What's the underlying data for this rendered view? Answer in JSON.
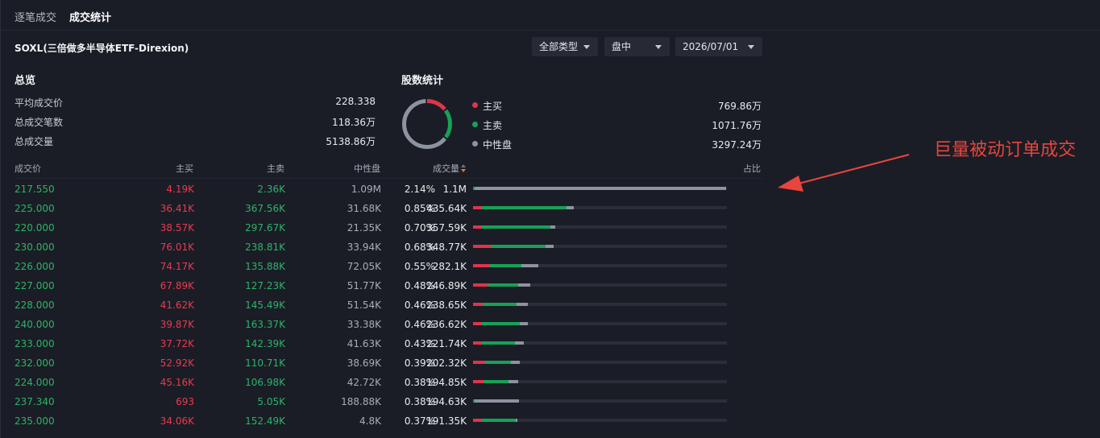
{
  "tabs": [
    "逐笔成交",
    "成交统计"
  ],
  "stock_title": "SOXL(三倍做多半导体ETF-Direxion)",
  "filters": {
    "type": "全部类型",
    "session": "盘中",
    "date": "2026/07/01"
  },
  "overview": {
    "title": "总览",
    "rows": [
      {
        "label": "平均成交价",
        "value": "228.338"
      },
      {
        "label": "总成交笔数",
        "value": "118.36万"
      },
      {
        "label": "总成交量",
        "value": "5138.86万"
      }
    ]
  },
  "share_stats": {
    "title": "股数统计",
    "items": [
      {
        "label": "主买",
        "value": "769.86万",
        "amount": 769.86,
        "color": "#e0344c"
      },
      {
        "label": "主卖",
        "value": "1071.76万",
        "amount": 1071.76,
        "color": "#17a157"
      },
      {
        "label": "中性盘",
        "value": "3297.24万",
        "amount": 3297.24,
        "color": "#8d939f"
      }
    ]
  },
  "table": {
    "headers": {
      "price": "成交价",
      "buy": "主买",
      "sell": "主卖",
      "neutral": "中性盘",
      "volume": "成交量",
      "ratio": "占比"
    },
    "rows": [
      {
        "price": "217.550",
        "buy": "4.19K",
        "sell": "2.36K",
        "neutral": "1.09M",
        "volume": "1.1M",
        "ratio": "2.14%",
        "b": 4.19,
        "s": 2.36,
        "n": 1090
      },
      {
        "price": "225.000",
        "buy": "36.41K",
        "sell": "367.56K",
        "neutral": "31.68K",
        "volume": "435.64K",
        "ratio": "0.85%",
        "b": 36.41,
        "s": 367.56,
        "n": 31.68
      },
      {
        "price": "220.000",
        "buy": "38.57K",
        "sell": "297.67K",
        "neutral": "21.35K",
        "volume": "357.59K",
        "ratio": "0.70%",
        "b": 38.57,
        "s": 297.67,
        "n": 21.35
      },
      {
        "price": "230.000",
        "buy": "76.01K",
        "sell": "238.81K",
        "neutral": "33.94K",
        "volume": "348.77K",
        "ratio": "0.68%",
        "b": 76.01,
        "s": 238.81,
        "n": 33.94
      },
      {
        "price": "226.000",
        "buy": "74.17K",
        "sell": "135.88K",
        "neutral": "72.05K",
        "volume": "282.1K",
        "ratio": "0.55%",
        "b": 74.17,
        "s": 135.88,
        "n": 72.05
      },
      {
        "price": "227.000",
        "buy": "67.89K",
        "sell": "127.23K",
        "neutral": "51.77K",
        "volume": "246.89K",
        "ratio": "0.48%",
        "b": 67.89,
        "s": 127.23,
        "n": 51.77
      },
      {
        "price": "228.000",
        "buy": "41.62K",
        "sell": "145.49K",
        "neutral": "51.54K",
        "volume": "238.65K",
        "ratio": "0.46%",
        "b": 41.62,
        "s": 145.49,
        "n": 51.54
      },
      {
        "price": "240.000",
        "buy": "39.87K",
        "sell": "163.37K",
        "neutral": "33.38K",
        "volume": "236.62K",
        "ratio": "0.46%",
        "b": 39.87,
        "s": 163.37,
        "n": 33.38
      },
      {
        "price": "233.000",
        "buy": "37.72K",
        "sell": "142.39K",
        "neutral": "41.63K",
        "volume": "221.74K",
        "ratio": "0.43%",
        "b": 37.72,
        "s": 142.39,
        "n": 41.63
      },
      {
        "price": "232.000",
        "buy": "52.92K",
        "sell": "110.71K",
        "neutral": "38.69K",
        "volume": "202.32K",
        "ratio": "0.39%",
        "b": 52.92,
        "s": 110.71,
        "n": 38.69
      },
      {
        "price": "224.000",
        "buy": "45.16K",
        "sell": "106.98K",
        "neutral": "42.72K",
        "volume": "194.85K",
        "ratio": "0.38%",
        "b": 45.16,
        "s": 106.98,
        "n": 42.72
      },
      {
        "price": "237.340",
        "buy": "693",
        "sell": "5.05K",
        "neutral": "188.88K",
        "volume": "194.63K",
        "ratio": "0.38%",
        "b": 0.693,
        "s": 5.05,
        "n": 188.88
      },
      {
        "price": "235.000",
        "buy": "34.06K",
        "sell": "152.49K",
        "neutral": "4.8K",
        "volume": "191.35K",
        "ratio": "0.37%",
        "b": 34.06,
        "s": 152.49,
        "n": 4.8
      }
    ]
  },
  "bar_max_volume": 1100,
  "colors": {
    "buy": "#e0344c",
    "sell": "#17a157",
    "neutral": "#8d939f",
    "annotation": "#e8453c"
  },
  "annotation": {
    "text": "巨量被动订单成交"
  }
}
